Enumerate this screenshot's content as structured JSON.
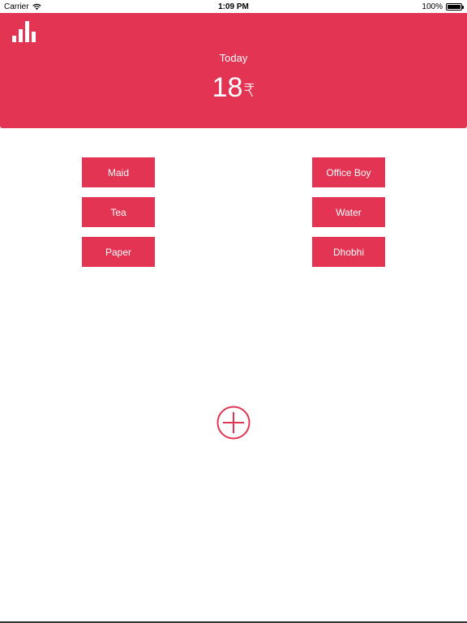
{
  "status_bar": {
    "carrier": "Carrier",
    "time": "1:09 PM",
    "battery": "100%"
  },
  "header": {
    "label": "Today",
    "amount": "18",
    "currency_symbol": "₹",
    "icon": "bar-chart-icon"
  },
  "categories": [
    {
      "label": "Maid"
    },
    {
      "label": "Office Boy"
    },
    {
      "label": "Tea"
    },
    {
      "label": "Water"
    },
    {
      "label": "Paper"
    },
    {
      "label": "Dhobhi"
    }
  ],
  "add_button": {
    "icon": "plus-circle-icon"
  },
  "colors": {
    "accent": "#e33553",
    "background": "#ffffff"
  }
}
